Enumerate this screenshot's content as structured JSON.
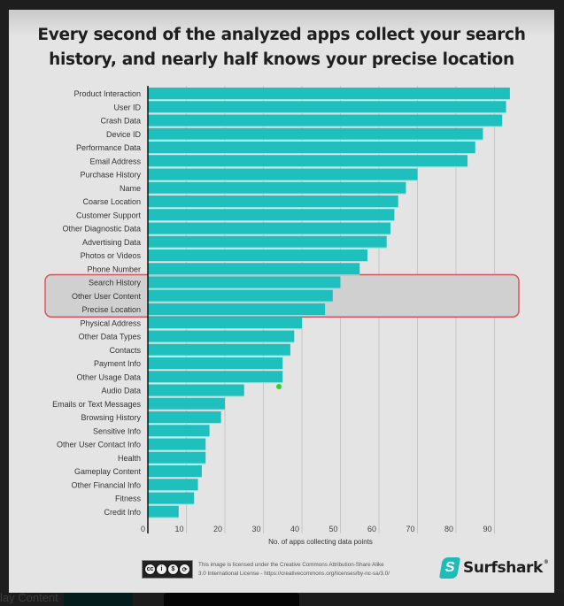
{
  "chart_data": {
    "type": "bar",
    "orientation": "horizontal",
    "title": "Every second of the analyzed apps collect your search history, and nearly half knows your precise location",
    "xlabel": "No. of apps collecting data points",
    "ylabel": "",
    "xlim": [
      0,
      95
    ],
    "xticks": [
      0,
      10,
      20,
      30,
      40,
      50,
      60,
      70,
      80,
      90
    ],
    "grid": true,
    "bar_color": "#1ebfbd",
    "highlight_color": "#e0525a",
    "highlighted_categories": [
      "Search History",
      "Other User Content",
      "Precise Location"
    ],
    "categories": [
      "Product Interaction",
      "User ID",
      "Crash Data",
      "Device ID",
      "Performance Data",
      "Email Address",
      "Purchase History",
      "Name",
      "Coarse Location",
      "Customer Support",
      "Other Diagnostic Data",
      "Advertising Data",
      "Photos or Videos",
      "Phone Number",
      "Search History",
      "Other User Content",
      "Precise Location",
      "Physical Address",
      "Other Data Types",
      "Contacts",
      "Payment Info",
      "Other Usage Data",
      "Audio Data",
      "Emails or Text Messages",
      "Browsing History",
      "Sensitive Info",
      "Other User Contact Info",
      "Health",
      "Gameplay Content",
      "Other Financial Info",
      "Fitness",
      "Credit Info"
    ],
    "values": [
      94,
      93,
      92,
      87,
      85,
      83,
      70,
      67,
      65,
      64,
      63,
      62,
      57,
      55,
      50,
      48,
      46,
      40,
      38,
      37,
      35,
      35,
      25,
      20,
      19,
      16,
      15,
      15,
      14,
      13,
      12,
      8
    ]
  },
  "header": {
    "title_line1": "Every second of the analyzed apps collect your search",
    "title_line2": "history, and nearly half knows your precise location"
  },
  "footer": {
    "license_line1": "This image is licensed under the Creative Commons Attribution-Share Alike",
    "license_line2": "3.0 International License - https://creativecommons.org/licenses/by-nc-sa/3.0/",
    "cc_icons": [
      "cc",
      "by",
      "nc",
      "sa"
    ],
    "brand": "Surfshark",
    "brand_reg": "®"
  },
  "background": {
    "partial_text": "lay Content"
  }
}
